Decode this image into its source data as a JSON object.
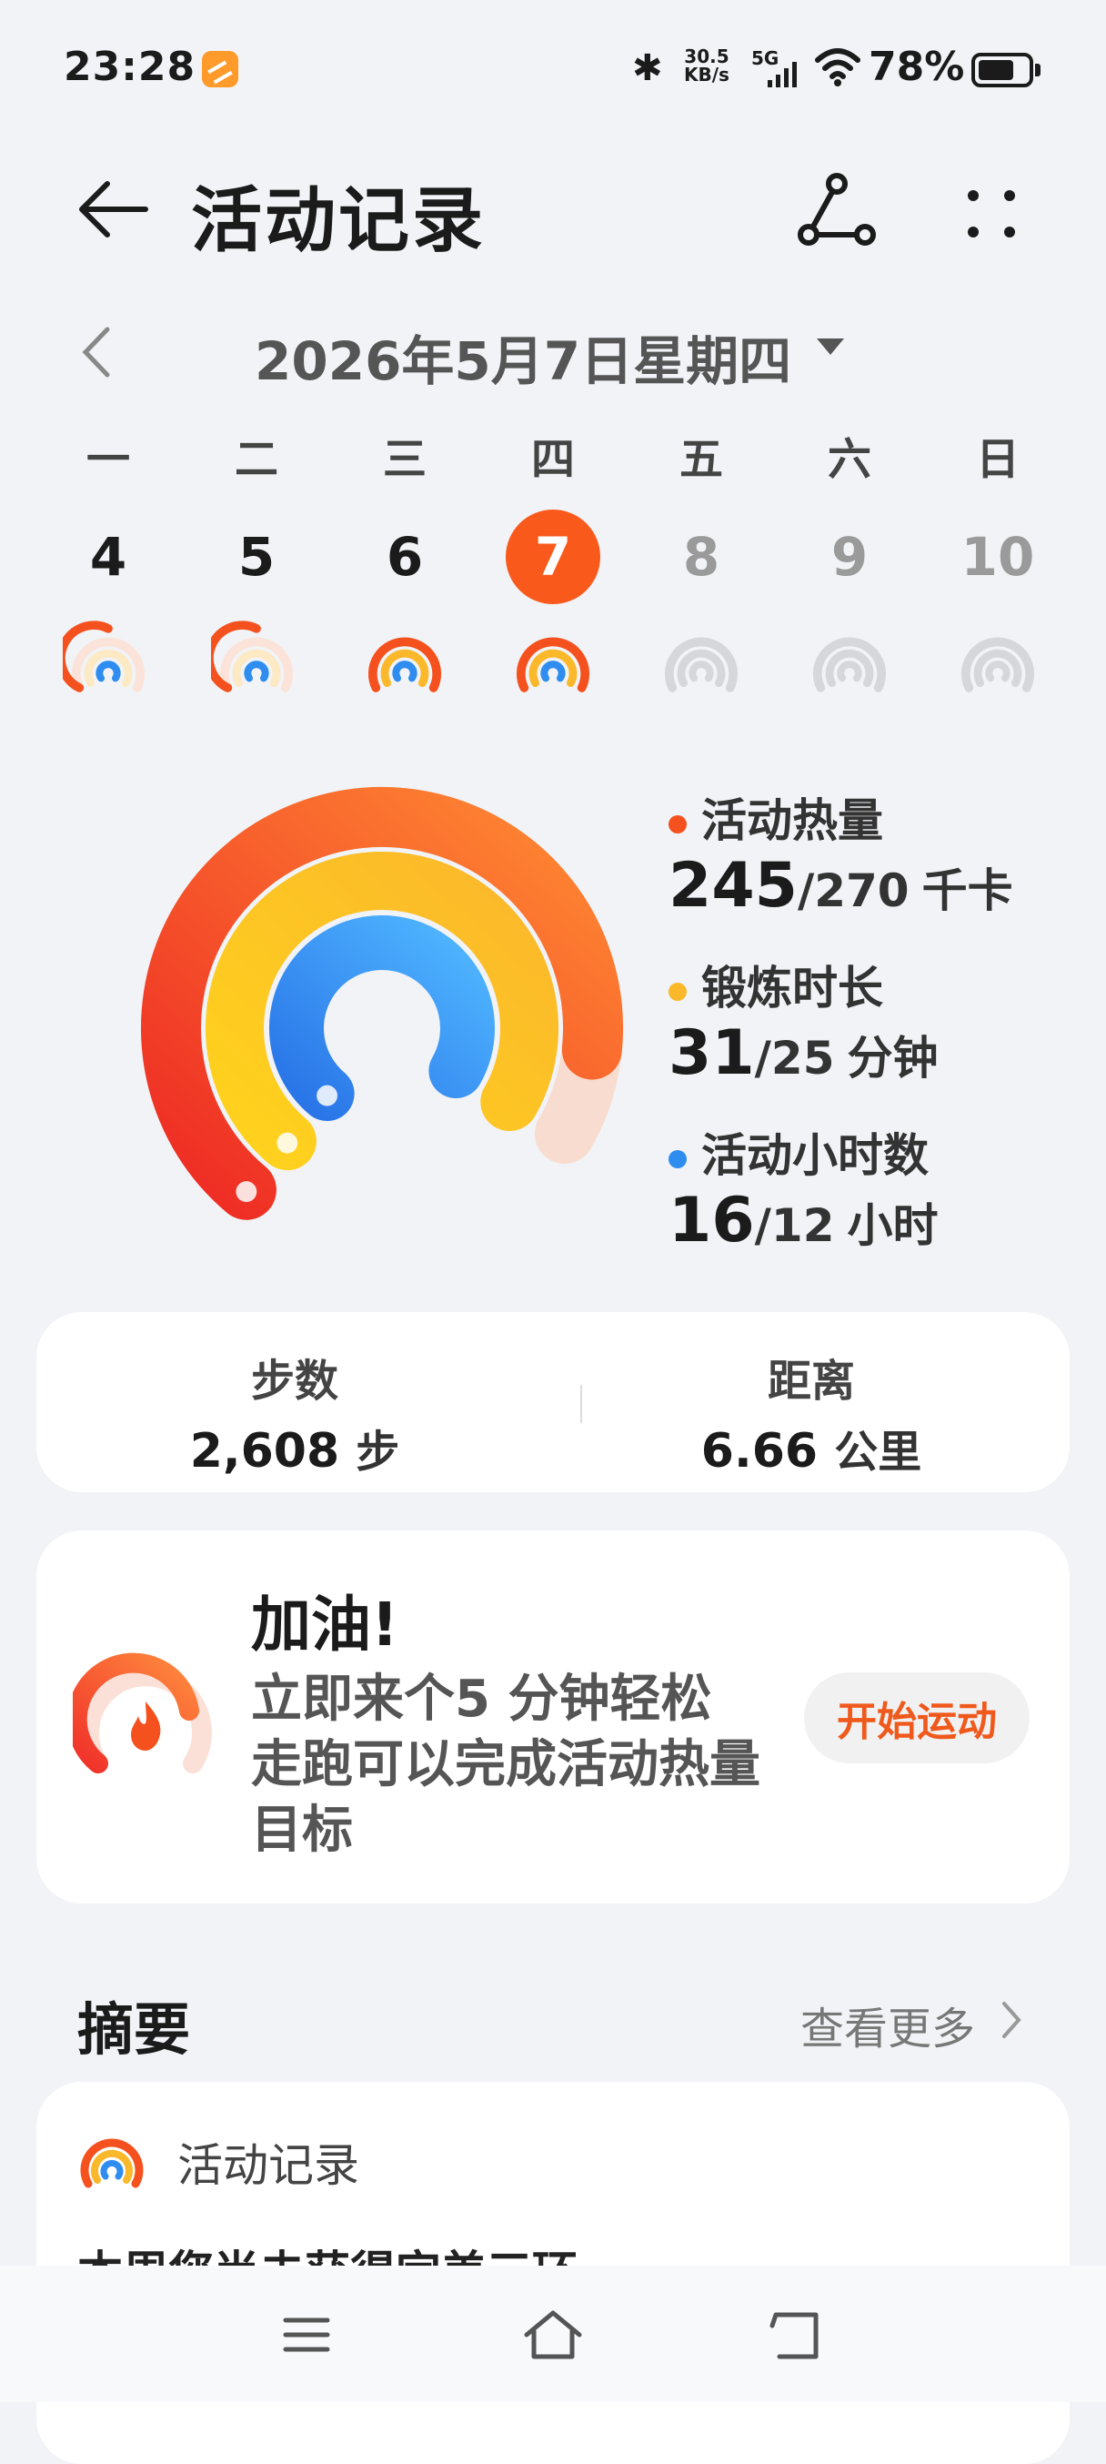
{
  "status_bar": {
    "time": "23:28",
    "net_speed_value": "30.5",
    "net_speed_unit": "KB/s",
    "network": "5G",
    "battery": "78%"
  },
  "header": {
    "title": "活动记录"
  },
  "date": {
    "label": "2026年5月7日星期四"
  },
  "week": [
    {
      "wd": "一",
      "num": "4",
      "state": "past"
    },
    {
      "wd": "二",
      "num": "5",
      "state": "past"
    },
    {
      "wd": "三",
      "num": "6",
      "state": "past"
    },
    {
      "wd": "四",
      "num": "7",
      "state": "active"
    },
    {
      "wd": "五",
      "num": "8",
      "state": "future"
    },
    {
      "wd": "六",
      "num": "9",
      "state": "future"
    },
    {
      "wd": "日",
      "num": "10",
      "state": "future"
    }
  ],
  "rings": {
    "calories": {
      "label": "活动热量",
      "value": "245",
      "goal": "/270",
      "unit": "千卡",
      "progress": 0.907,
      "color": "#f4511e"
    },
    "exercise": {
      "label": "锻炼时长",
      "value": "31",
      "goal": "/25",
      "unit": "分钟",
      "progress": 1.24,
      "color": "#fbb82b"
    },
    "hours": {
      "label": "活动小时数",
      "value": "16",
      "goal": "/12",
      "unit": "小时",
      "progress": 1.33,
      "color": "#2f8df0"
    }
  },
  "stats": {
    "steps": {
      "label": "步数",
      "value": "2,608",
      "unit": "步"
    },
    "distance": {
      "label": "距离",
      "value": "6.66",
      "unit": "公里"
    }
  },
  "promo": {
    "heading": "加油!",
    "text": "立即来个5 分钟轻松走跑可以完成活动热量目标",
    "button": "开始运动"
  },
  "summary": {
    "title": "摘要",
    "more": "查看更多",
    "card_title": "活动记录",
    "card_text": "本周您尚未获得完美三环"
  }
}
